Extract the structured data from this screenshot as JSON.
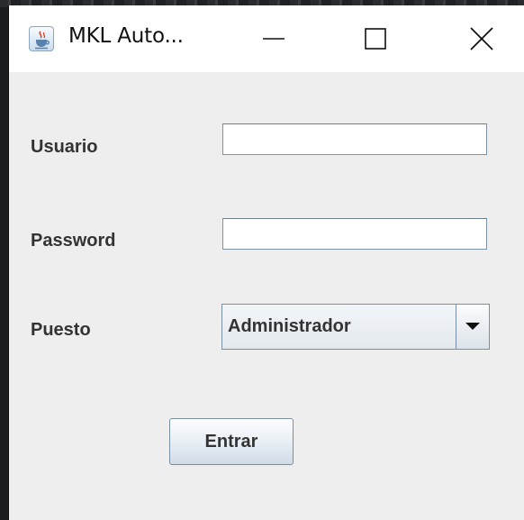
{
  "window": {
    "title": "MKL Auto...",
    "icon": "java-cup-icon"
  },
  "titlebar": {
    "controls": [
      "minimize-icon",
      "maximize-icon",
      "close-icon"
    ]
  },
  "form": {
    "usuario": {
      "label": "Usuario",
      "value": ""
    },
    "password": {
      "label": "Password",
      "value": ""
    },
    "puesto": {
      "label": "Puesto",
      "selected": "Administrador"
    },
    "submit_label": "Entrar"
  },
  "colors": {
    "window_background": "#eeeeee",
    "titlebar_background": "#ffffff",
    "label_text": "#333333",
    "field_border": "#7f93a6"
  }
}
